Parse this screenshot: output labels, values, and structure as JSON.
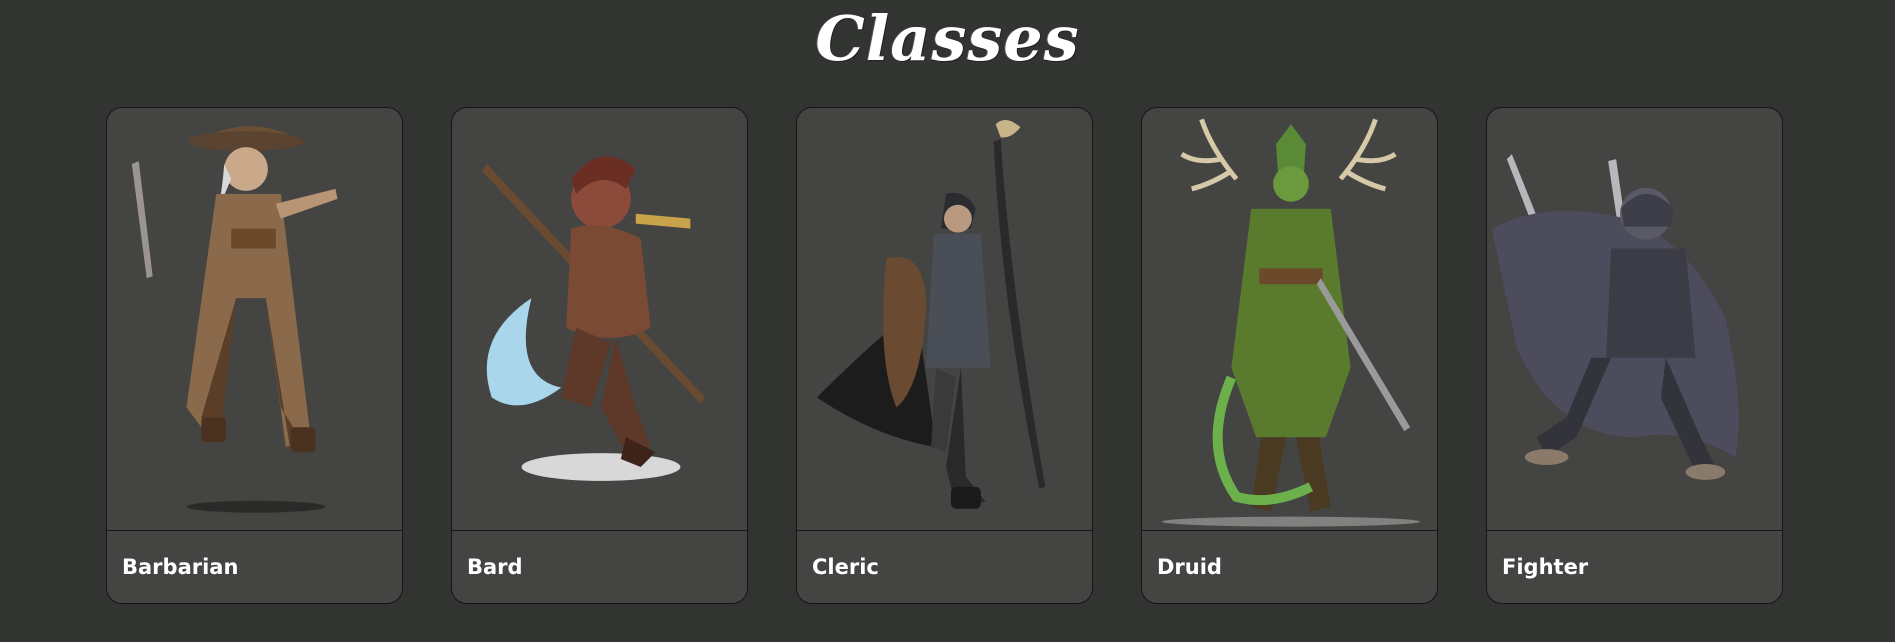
{
  "page": {
    "title": "Classes"
  },
  "classes": [
    {
      "name": "Barbarian",
      "icon": "barbarian-figure-icon",
      "accent": "#8a6a4a"
    },
    {
      "name": "Bard",
      "icon": "bard-figure-icon",
      "accent": "#8c4a3a"
    },
    {
      "name": "Cleric",
      "icon": "cleric-figure-icon",
      "accent": "#4a4e57"
    },
    {
      "name": "Druid",
      "icon": "druid-figure-icon",
      "accent": "#5a7a2e"
    },
    {
      "name": "Fighter",
      "icon": "fighter-figure-icon",
      "accent": "#4c4c5c"
    }
  ]
}
